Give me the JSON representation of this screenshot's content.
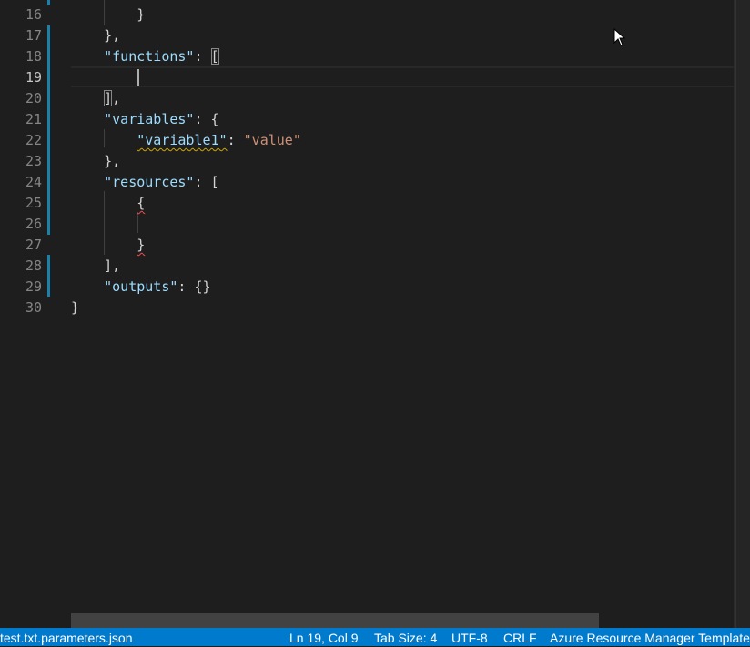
{
  "editor": {
    "lines": [
      {
        "n": "16",
        "segments": [
          {
            "t": "        }",
            "c": "pun"
          }
        ]
      },
      {
        "n": "17",
        "segments": [
          {
            "t": "    },",
            "c": "pun"
          }
        ]
      },
      {
        "n": "18",
        "segments": [
          {
            "t": "    ",
            "c": "pun"
          },
          {
            "t": "\"functions\"",
            "c": "key"
          },
          {
            "t": ": ",
            "c": "pun"
          },
          {
            "t": "[",
            "c": "pun box"
          }
        ]
      },
      {
        "n": "19",
        "segments": []
      },
      {
        "n": "20",
        "segments": [
          {
            "t": "    ",
            "c": "pun"
          },
          {
            "t": "]",
            "c": "pun box"
          },
          {
            "t": ",",
            "c": "pun"
          }
        ]
      },
      {
        "n": "21",
        "segments": [
          {
            "t": "    ",
            "c": "pun"
          },
          {
            "t": "\"variables\"",
            "c": "key"
          },
          {
            "t": ": {",
            "c": "pun"
          }
        ]
      },
      {
        "n": "22",
        "segments": [
          {
            "t": "        ",
            "c": "pun"
          },
          {
            "t": "\"variable1\"",
            "c": "key squig"
          },
          {
            "t": ": ",
            "c": "pun"
          },
          {
            "t": "\"value\"",
            "c": "str"
          }
        ]
      },
      {
        "n": "23",
        "segments": [
          {
            "t": "    },",
            "c": "pun"
          }
        ]
      },
      {
        "n": "24",
        "segments": [
          {
            "t": "    ",
            "c": "pun"
          },
          {
            "t": "\"resources\"",
            "c": "key"
          },
          {
            "t": ": [",
            "c": "pun"
          }
        ]
      },
      {
        "n": "25",
        "segments": [
          {
            "t": "        ",
            "c": "pun"
          },
          {
            "t": "{",
            "c": "pun squig-red"
          }
        ]
      },
      {
        "n": "26",
        "segments": []
      },
      {
        "n": "27",
        "segments": [
          {
            "t": "        ",
            "c": "pun"
          },
          {
            "t": "}",
            "c": "pun squig-red"
          }
        ]
      },
      {
        "n": "28",
        "segments": [
          {
            "t": "    ],",
            "c": "pun"
          }
        ]
      },
      {
        "n": "29",
        "segments": [
          {
            "t": "    ",
            "c": "pun"
          },
          {
            "t": "\"outputs\"",
            "c": "key"
          },
          {
            "t": ": {}",
            "c": "pun"
          }
        ]
      },
      {
        "n": "30",
        "segments": [
          {
            "t": "}",
            "c": "pun"
          }
        ]
      }
    ],
    "active_line": "19"
  },
  "statusbar": {
    "filename": "test.txt.parameters.json",
    "position": "Ln 19, Col 9",
    "tab_size": "Tab Size: 4",
    "encoding": "UTF-8",
    "eol": "CRLF",
    "language": "Azure Resource Manager Template"
  },
  "colors": {
    "background": "#1e1e1e",
    "statusbar": "#007acc",
    "key": "#9cdcfe",
    "string": "#ce9178",
    "gutter_modified": "#1b81a8"
  }
}
